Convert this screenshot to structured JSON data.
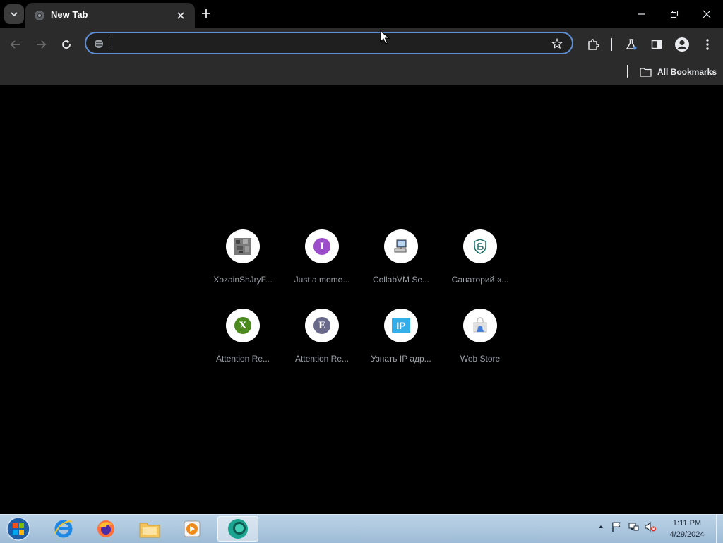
{
  "tab": {
    "title": "New Tab"
  },
  "omnibox": {
    "value": "",
    "placeholder": ""
  },
  "bookmarks": {
    "all_label": "All Bookmarks"
  },
  "shortcuts": [
    {
      "label": "XozainShJryF...",
      "icon": "pixel-thumbnail"
    },
    {
      "label": "Just a mome...",
      "icon": "letter",
      "letter": "I",
      "color": "#9c4dcc"
    },
    {
      "label": "CollabVM Se...",
      "icon": "computer-icon"
    },
    {
      "label": "Санаторий «...",
      "icon": "shield-emblem"
    },
    {
      "label": "Attention Re...",
      "icon": "letter",
      "letter": "X",
      "color": "#4c8a1f"
    },
    {
      "label": "Attention Re...",
      "icon": "letter",
      "letter": "E",
      "color": "#6a6a8a"
    },
    {
      "label": "Узнать IP адр...",
      "icon": "ip-badge",
      "text": "IP"
    },
    {
      "label": "Web Store",
      "icon": "web-store-icon"
    }
  ],
  "taskbar": {
    "apps": [
      "start-orb",
      "internet-explorer",
      "firefox",
      "file-explorer",
      "media-player",
      "chrome"
    ],
    "clock": {
      "time": "1:11 PM",
      "date": "4/29/2024"
    }
  },
  "colors": {
    "omnibox_focus": "#5e8fd5",
    "toolbar": "#2b2b2b",
    "background": "#000000"
  }
}
